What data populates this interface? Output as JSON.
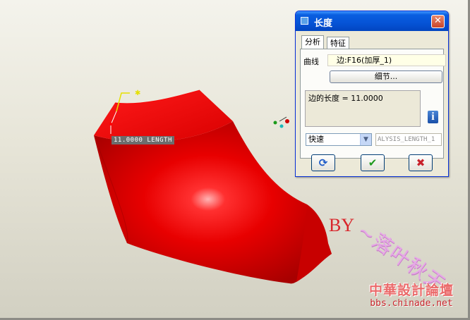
{
  "viewport": {
    "dimension_label": "11.0000 LENGTH",
    "watermark_by": "BY",
    "watermark_signature": "~落叶秋天",
    "forum_name": "中華設計論壇",
    "forum_url": "bbs.chinade.net"
  },
  "dialog": {
    "title": "长度",
    "close_label": "✕",
    "tabs": [
      {
        "label": "分析",
        "active": true
      },
      {
        "label": "特征",
        "active": false
      }
    ],
    "curve_label": "曲线",
    "curve_value": "边:F16(加厚_1)",
    "detail_button": "细节...",
    "result_text": "边的长度 = 11.0000",
    "info_icon": "i",
    "mode_value": "快速",
    "param_value": "ALYSIS_LENGTH_1",
    "buttons": {
      "repeat_icon": "⟳",
      "ok_icon": "✔",
      "cancel_icon": "✖"
    }
  },
  "colors": {
    "part_red": "#e00000",
    "titlebar_blue": "#0553d6"
  }
}
